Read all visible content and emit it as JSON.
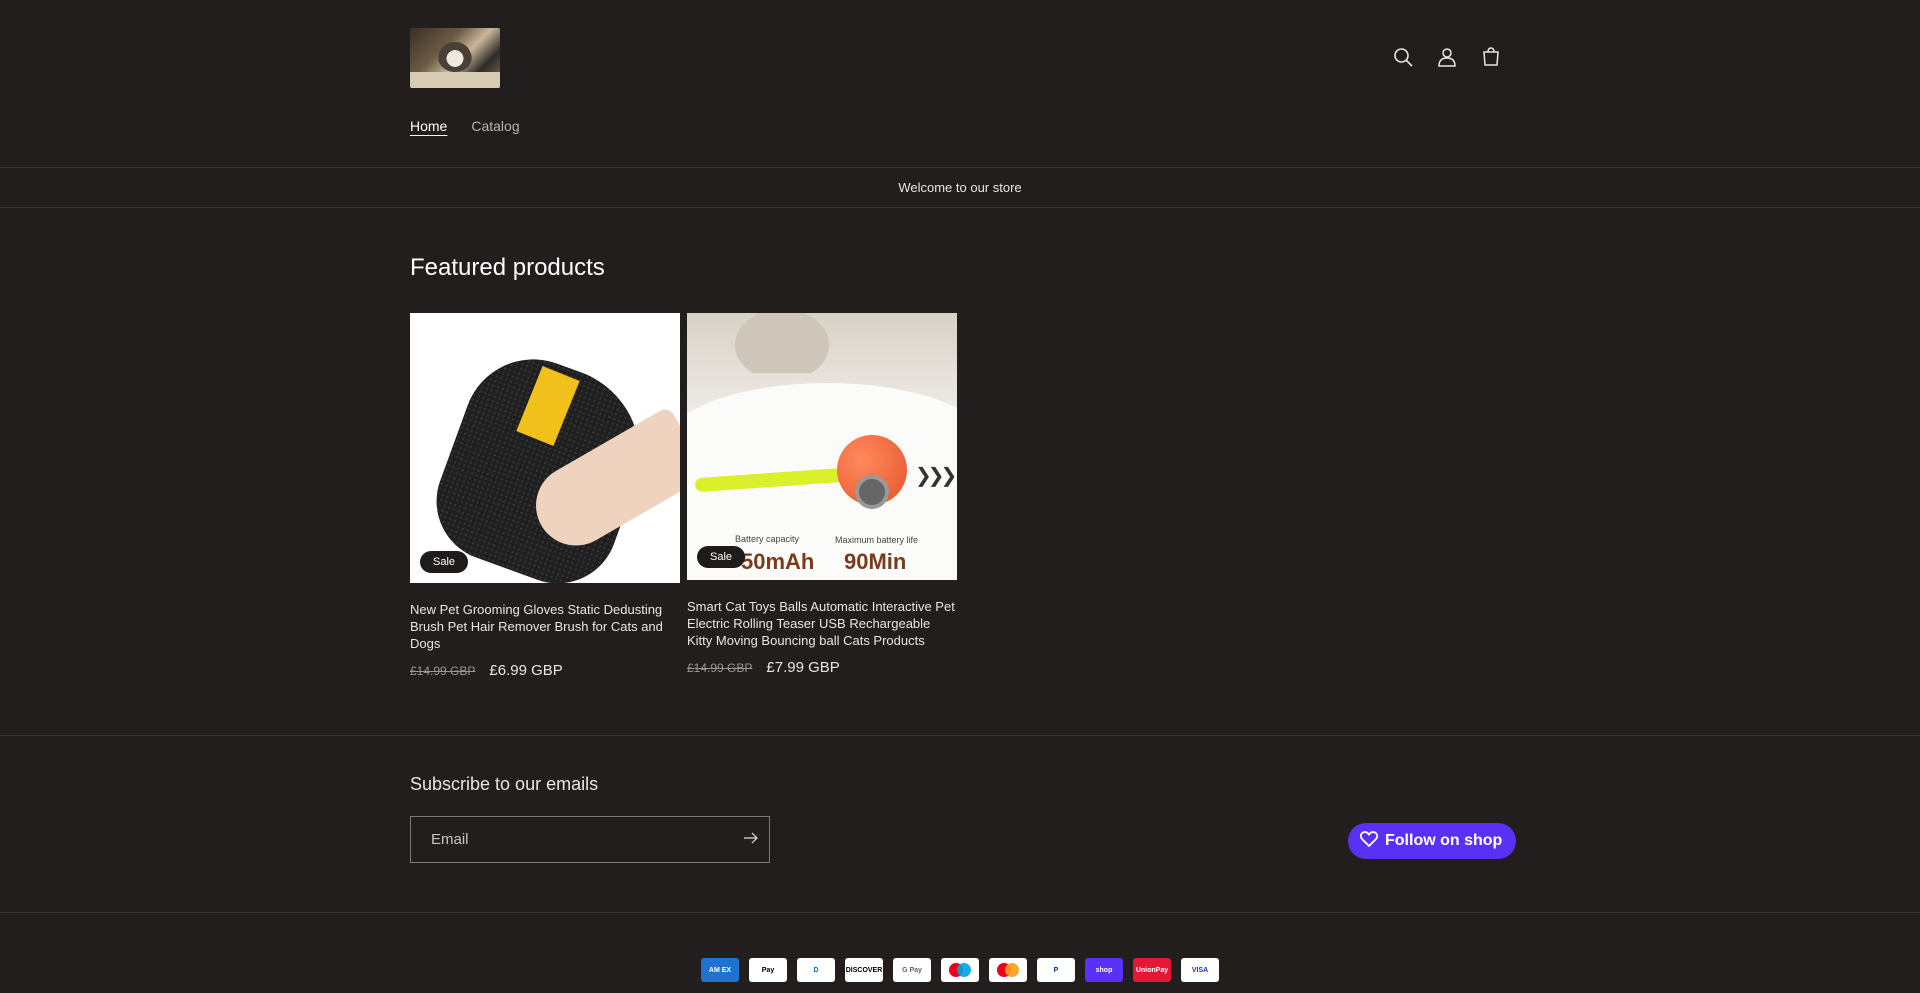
{
  "header": {
    "nav": [
      {
        "label": "Home",
        "active": true
      },
      {
        "label": "Catalog",
        "active": false
      }
    ],
    "icons": [
      "search-icon",
      "account-icon",
      "cart-icon"
    ]
  },
  "announcement": "Welcome to our store",
  "featured": {
    "title": "Featured products",
    "products": [
      {
        "title": "New Pet Grooming Gloves Static Dedusting Brush Pet Hair Remover Brush for Cats and Dogs",
        "badge": "Sale",
        "old_price": "£14.99 GBP",
        "new_price": "£6.99 GBP"
      },
      {
        "title": "Smart Cat Toys Balls Automatic Interactive Pet Electric Rolling Teaser USB Rechargeable Kitty Moving Bouncing ball Cats Products",
        "badge": "Sale",
        "old_price": "£14.99 GBP",
        "new_price": "£7.99 GBP",
        "image_text": {
          "battery_label": "Battery capacity",
          "battery_value": "50mAh",
          "life_label": "Maximum battery life",
          "life_value": "90Min"
        }
      }
    ]
  },
  "newsletter": {
    "title": "Subscribe to our emails",
    "email_placeholder": "Email",
    "follow_label": "Follow on shop"
  },
  "payments": [
    {
      "name": "American Express",
      "label": "AM EX",
      "bg": "#1f72cd",
      "fg": "#ffffff"
    },
    {
      "name": "Apple Pay",
      "label": " Pay",
      "bg": "#ffffff",
      "fg": "#000000"
    },
    {
      "name": "Diners Club",
      "label": "D",
      "bg": "#ffffff",
      "fg": "#0079be"
    },
    {
      "name": "Discover",
      "label": "DISCOVER",
      "bg": "#ffffff",
      "fg": "#000000"
    },
    {
      "name": "Google Pay",
      "label": "G Pay",
      "bg": "#ffffff",
      "fg": "#5f6368"
    },
    {
      "name": "Maestro",
      "label": "",
      "bg": "#ffffff",
      "fg": "#000000"
    },
    {
      "name": "Mastercard",
      "label": "",
      "bg": "#ffffff",
      "fg": "#000000"
    },
    {
      "name": "PayPal",
      "label": "P",
      "bg": "#ffffff",
      "fg": "#003087"
    },
    {
      "name": "Shop Pay",
      "label": "shop",
      "bg": "#5a31f4",
      "fg": "#ffffff"
    },
    {
      "name": "UnionPay",
      "label": "UnionPay",
      "bg": "#e21836",
      "fg": "#ffffff"
    },
    {
      "name": "Visa",
      "label": "VISA",
      "bg": "#ffffff",
      "fg": "#1434cb"
    }
  ]
}
